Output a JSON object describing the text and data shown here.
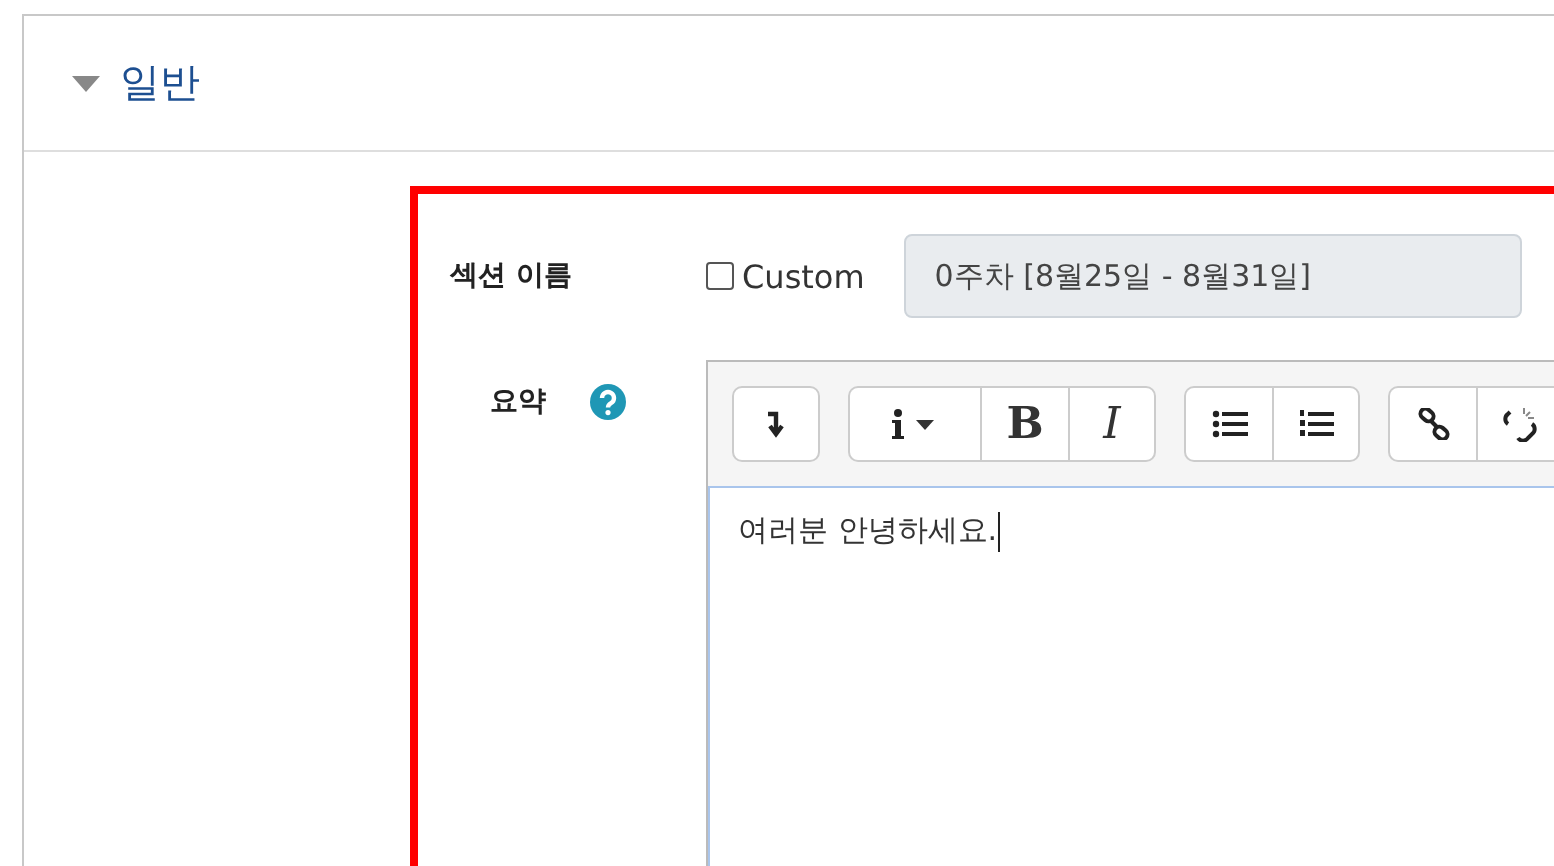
{
  "section": {
    "title": "일반",
    "expanded": true
  },
  "form": {
    "name_label": "섹션 이름",
    "custom": {
      "label": "Custom",
      "checked": false
    },
    "name_value": "0주차 [8월25일 - 8월31일]",
    "summary_label": "요약",
    "toolbar": [
      [
        {
          "kind": "arrow"
        }
      ],
      [
        {
          "kind": "info"
        },
        {
          "kind": "bold",
          "label": "B"
        },
        {
          "kind": "italic",
          "label": "I"
        }
      ],
      [
        {
          "kind": "bullets"
        },
        {
          "kind": "numbers"
        }
      ],
      [
        {
          "kind": "link"
        },
        {
          "kind": "unlink"
        }
      ]
    ],
    "editor_text": "여러분 안녕하세요."
  }
}
